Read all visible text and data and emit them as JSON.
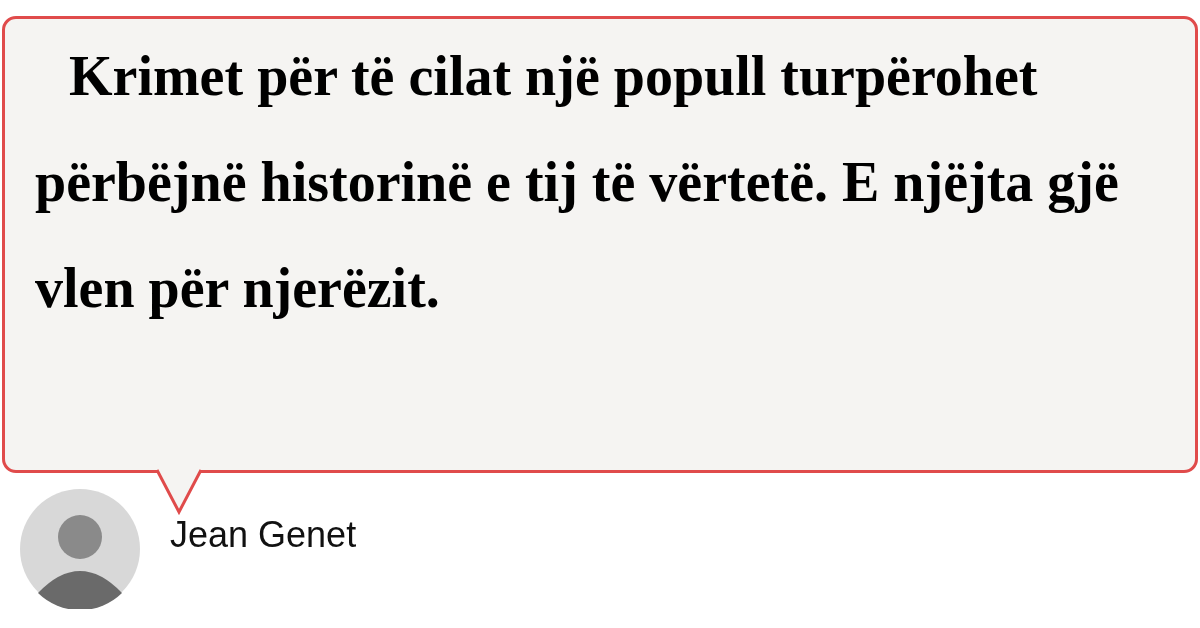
{
  "quote": {
    "text": "Krimet për të cilat një popull turpërohet përbëjnë historinë e tij të vërtetë. E njëjta gjë vlen për njerëzit."
  },
  "author": {
    "name": "Jean Genet"
  }
}
